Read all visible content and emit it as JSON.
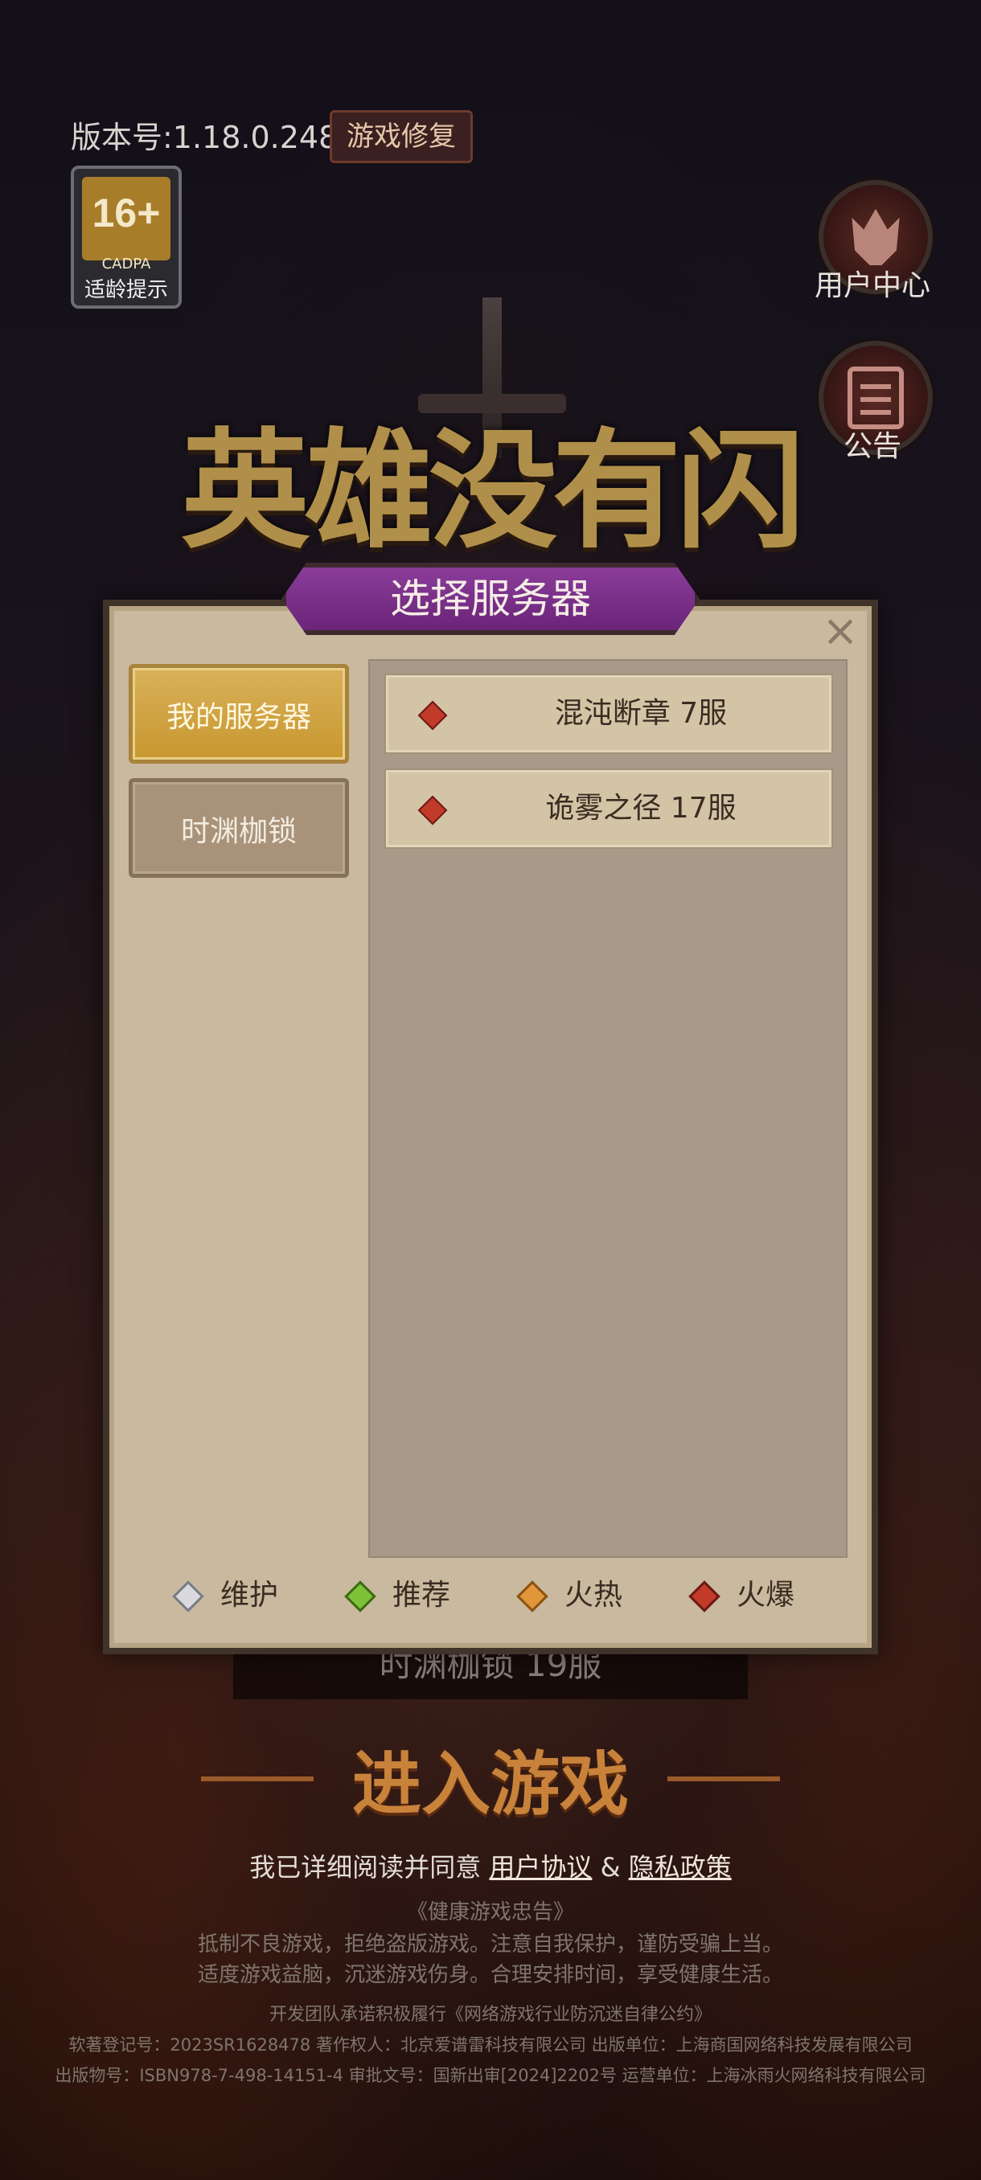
{
  "top": {
    "version": "版本号:1.18.0.248",
    "repair_button": "游戏修复",
    "age_rating": {
      "number": "16+",
      "brand": "CADPA",
      "tip": "适龄提示"
    }
  },
  "side": {
    "user_center": "用户中心",
    "notice": "公告"
  },
  "logo_text": "英雄没有闪",
  "dialog": {
    "title": "选择服务器",
    "close_symbol": "×",
    "tabs": [
      {
        "label": "我的服务器",
        "active": true
      },
      {
        "label": "时渊枷锁",
        "active": false
      }
    ],
    "servers": [
      {
        "name": "混沌断章 7服",
        "status": "火爆"
      },
      {
        "name": "诡雾之径 17服",
        "status": "火爆"
      }
    ],
    "legend": [
      {
        "label": "维护",
        "color": "#9a9aa4"
      },
      {
        "label": "推荐",
        "color": "#7ec23a"
      },
      {
        "label": "火热",
        "color": "#e1963a"
      },
      {
        "label": "火爆",
        "color": "#c23a2a"
      }
    ]
  },
  "bottom": {
    "current_server": "时渊枷锁 19服",
    "enter_game": "进入游戏",
    "agree_prefix": "我已详细阅读并同意",
    "user_agreement": "用户协议",
    "amp": "&",
    "privacy_policy": "隐私政策",
    "health_title": "《健康游戏忠告》",
    "health_line1": "抵制不良游戏，拒绝盗版游戏。注意自我保护，谨防受骗上当。",
    "health_line2": "适度游戏益脑，沉迷游戏伤身。合理安排时间，享受健康生活。",
    "pledge": "开发团队承诺积极履行《网络游戏行业防沉迷自律公约》",
    "reg_line": "软著登记号：2023SR1628478  著作权人：北京爱谱雷科技有限公司  出版单位：上海商国网络科技发展有限公司",
    "isbn_line": "出版物号：ISBN978-7-498-14151-4 审批文号：国新出审[2024]2202号 运营单位：上海冰雨火网络科技有限公司"
  }
}
